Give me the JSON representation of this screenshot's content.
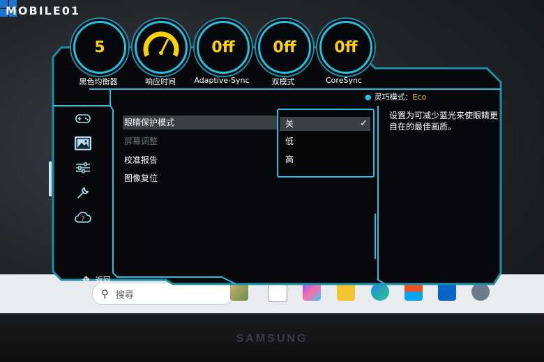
{
  "watermark": "MOBILE01",
  "gauges": [
    {
      "value": "5",
      "label": "黑色均衡器"
    },
    {
      "value": "",
      "label": "响应时间"
    },
    {
      "value": "0ff",
      "label": "Adaptive-Sync"
    },
    {
      "value": "0ff",
      "label": "双模式"
    },
    {
      "value": "0ff",
      "label": "CoreSync"
    }
  ],
  "eco_mode": {
    "label": "灵巧模式：",
    "value": "Eco"
  },
  "sidebar_icons": [
    "game-controller-icon",
    "picture-icon",
    "sliders-icon",
    "wrench-icon",
    "cloud-help-icon"
  ],
  "menu": {
    "items": [
      {
        "label": "眼睛保护模式",
        "state": "selected"
      },
      {
        "label": "屏幕调整",
        "state": "disabled"
      },
      {
        "label": "校准报告",
        "state": "normal"
      },
      {
        "label": "图像复位",
        "state": "normal"
      }
    ]
  },
  "dropdown": {
    "options": [
      {
        "label": "关",
        "selected": true
      },
      {
        "label": "低",
        "selected": false
      },
      {
        "label": "高",
        "selected": false
      }
    ],
    "check_glyph": "✓"
  },
  "description": "设置为可减少蓝光来使眼睛更自在的最佳画质。",
  "back": {
    "glyph": "✥",
    "label": "返回"
  },
  "taskbar": {
    "search_placeholder": "搜尋",
    "search_glyph": "⚲"
  },
  "brand": "SAMSUNG",
  "colors": {
    "accent": "#22c1e0",
    "highlight": "#ffd200",
    "osd_bg": "#06080b"
  }
}
